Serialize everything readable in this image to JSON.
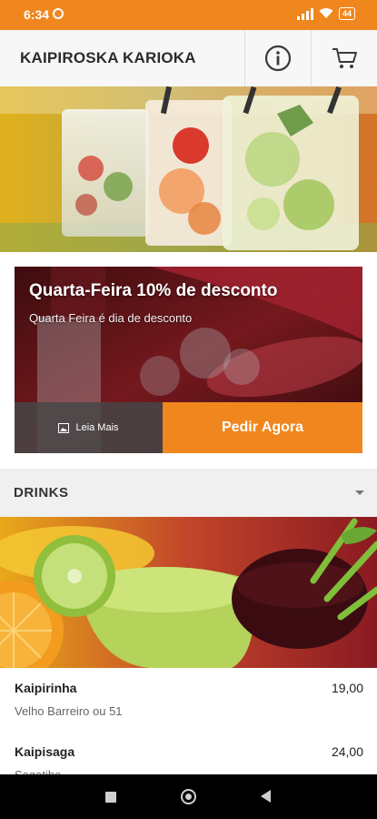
{
  "status_bar": {
    "time": "6:34",
    "battery": "44"
  },
  "header": {
    "title": "KAIPIROSKA KARIOKA"
  },
  "promo": {
    "title": "Quarta-Feira 10% de desconto",
    "subtitle": "Quarta Feira é dia de desconto",
    "read_more_label": "Leia Mais",
    "order_label": "Pedir Agora"
  },
  "section": {
    "title": "DRINKS"
  },
  "items": [
    {
      "name": "Kaipirinha",
      "description": "Velho Barreiro ou 51",
      "price": "19,00"
    },
    {
      "name": "Kaipisaga",
      "description": "Sagatiba",
      "price": "24,00"
    }
  ],
  "colors": {
    "accent": "#F0871E"
  },
  "icons": [
    "alarm-icon",
    "signal-icon",
    "wifi-icon",
    "battery-icon",
    "info-icon",
    "cart-icon",
    "image-icon",
    "caret-down-icon",
    "back-icon",
    "home-icon",
    "recents-icon"
  ]
}
